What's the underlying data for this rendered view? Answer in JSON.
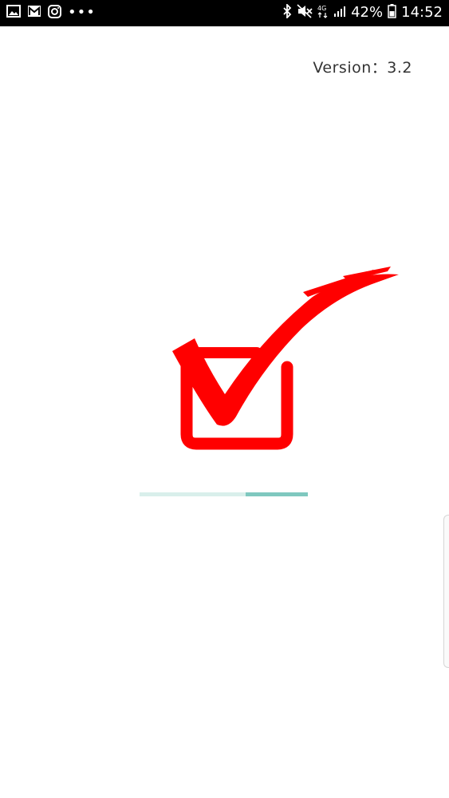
{
  "status_bar": {
    "battery": "42%",
    "time": "14:52",
    "network": "4G",
    "icons_left": [
      "gallery-icon",
      "mail-icon",
      "instagram-icon",
      "more-notifications-icon"
    ],
    "icons_right": [
      "bluetooth-icon",
      "mute-icon",
      "network-4g-icon",
      "signal-icon",
      "battery-icon"
    ]
  },
  "splash": {
    "version_text": "Version：3.2",
    "logo": "red-checkbox-checkmark",
    "logo_color": "#ff0000"
  },
  "progress": {
    "fraction_start": 0.63,
    "fraction_end": 1.0,
    "track_color": "#d9efeb",
    "fill_color": "#7fc8bf"
  }
}
